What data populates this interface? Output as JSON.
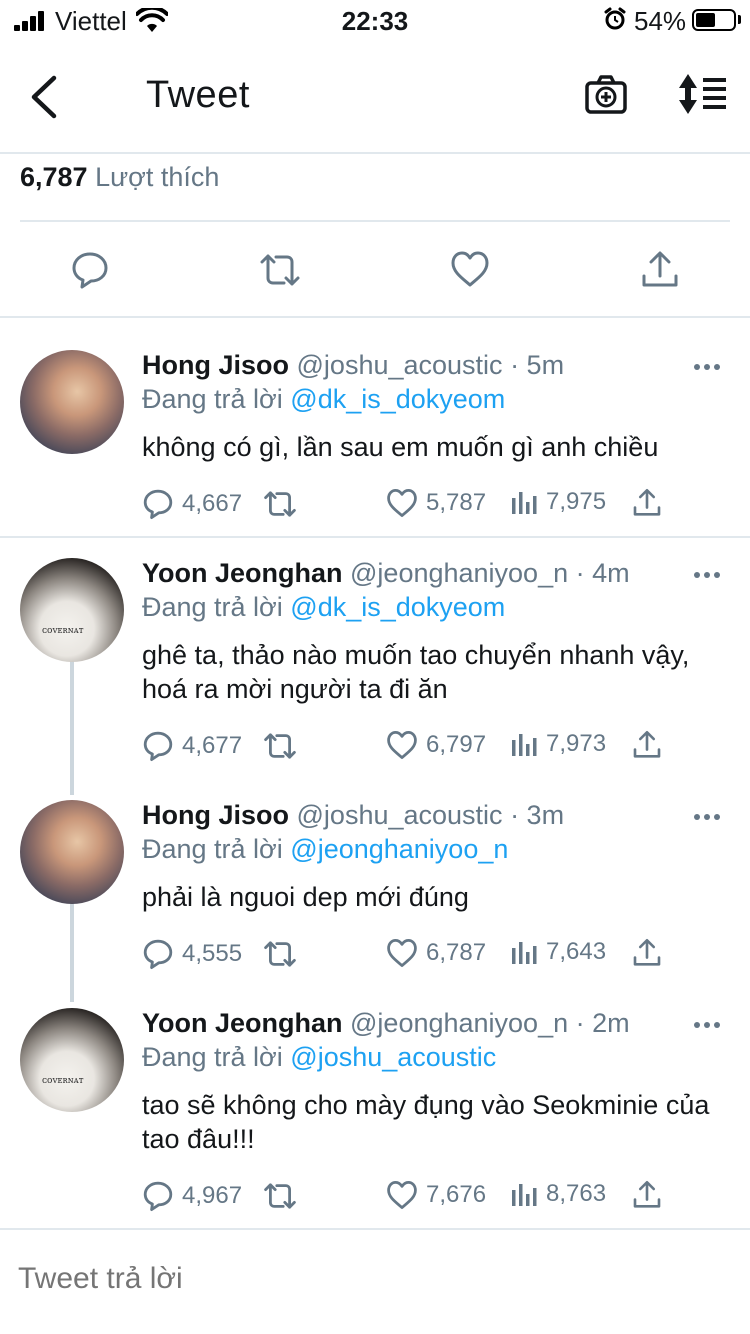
{
  "status_bar": {
    "carrier": "Viettel",
    "time": "22:33",
    "battery": "54%",
    "battery_level": 0.54
  },
  "nav": {
    "title": "Tweet",
    "back_icon": "chevron-left-icon",
    "camera_icon": "camera-add-icon",
    "sort_icon": "sort-icon"
  },
  "stats": {
    "likes_count": "6,787",
    "likes_label": "Lượt thích"
  },
  "actions": [
    "reply-icon",
    "retweet-icon",
    "like-icon",
    "share-icon"
  ],
  "replies": [
    {
      "name": "Hong Jisoo",
      "handle": "@joshu_acoustic",
      "time": "· 5m",
      "replying_prefix": "Đang trả lời",
      "replying_to": "@dk_is_dokyeom",
      "text": "không có gì, lần sau em muốn gì anh chiều",
      "replies": "4,667",
      "likes": "5,787",
      "views": "7,975"
    },
    {
      "name": "Yoon Jeonghan",
      "handle": "@jeonghaniyoo_n",
      "time": "· 4m",
      "replying_prefix": "Đang trả lời",
      "replying_to": "@dk_is_dokyeom",
      "text": "ghê ta, thảo nào muốn tao chuyển nhanh vậy, hoá ra mời người ta đi ăn",
      "replies": "4,677",
      "likes": "6,797",
      "views": "7,973"
    },
    {
      "name": "Hong Jisoo",
      "handle": "@joshu_acoustic",
      "time": "· 3m",
      "replying_prefix": "Đang trả lời",
      "replying_to": "@jeonghaniyoo_n",
      "text": "phải là nguoi dep mới đúng",
      "replies": "4,555",
      "likes": "6,787",
      "views": "7,643"
    },
    {
      "name": "Yoon Jeonghan",
      "handle": "@jeonghaniyoo_n",
      "time": "· 2m",
      "replying_prefix": "Đang trả lời",
      "replying_to": "@joshu_acoustic",
      "text": "tao sẽ không cho mày đụng vào Seokminie của tao đâu!!!",
      "replies": "4,967",
      "likes": "7,676",
      "views": "8,763"
    }
  ],
  "composer": {
    "placeholder": "Tweet trả lời"
  },
  "colors": {
    "accent": "#1da1f2",
    "secondary_text": "#657786",
    "divider": "#e1e8ed"
  }
}
